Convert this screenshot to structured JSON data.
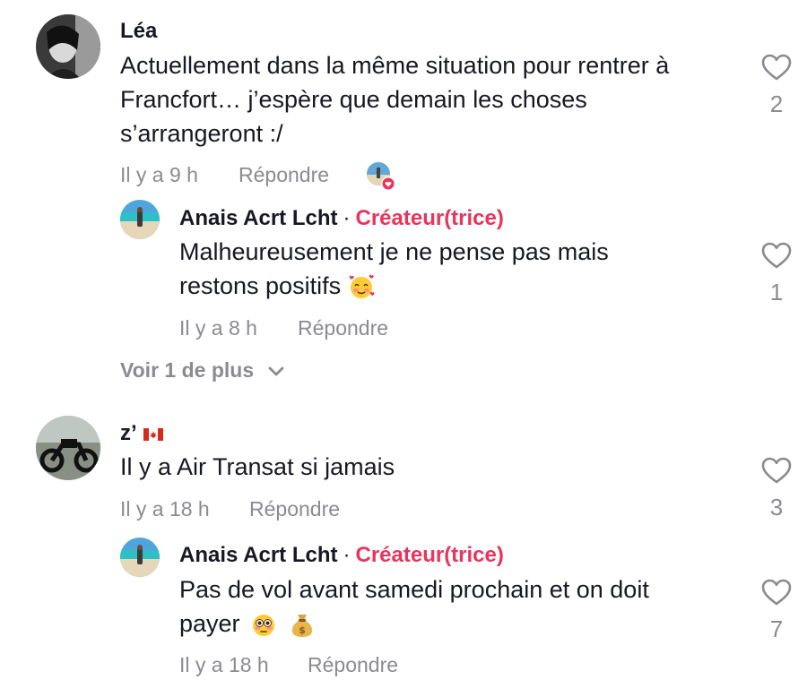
{
  "comments": [
    {
      "username": "Léa",
      "text_lines": [
        "Actuellement dans la même situation pour rentrer à",
        "Francfort… j’espère que demain les choses",
        "s’arrangeront :/"
      ],
      "time": "Il y a 9 h",
      "reply_label": "Répondre",
      "likes": "2",
      "replies": [
        {
          "username": "Anais Acrt Lcht",
          "separator": "·",
          "creator_badge": "Créateur(trice)",
          "text_lines": [
            "Malheureusement je ne pense pas mais",
            "restons positifs"
          ],
          "emoji": "smiling-face-with-hearts",
          "time": "Il y a 8 h",
          "reply_label": "Répondre",
          "likes": "1"
        }
      ],
      "view_more": "Voir 1 de plus"
    },
    {
      "username": "z’",
      "flag": "canada-flag",
      "text_lines": [
        "Il y a Air Transat si jamais"
      ],
      "time": "Il y a 18 h",
      "reply_label": "Répondre",
      "likes": "3",
      "replies": [
        {
          "username": "Anais Acrt Lcht",
          "separator": "·",
          "creator_badge": "Créateur(trice)",
          "text_lines": [
            "Pas de vol avant samedi prochain et on doit",
            "payer"
          ],
          "emoji": "flushed-face, money-bag",
          "time": "Il y a 18 h",
          "reply_label": "Répondre",
          "likes": "7"
        }
      ]
    }
  ],
  "colors": {
    "text": "#161823",
    "muted": "#8a8b91",
    "creator": "#e8355b"
  }
}
